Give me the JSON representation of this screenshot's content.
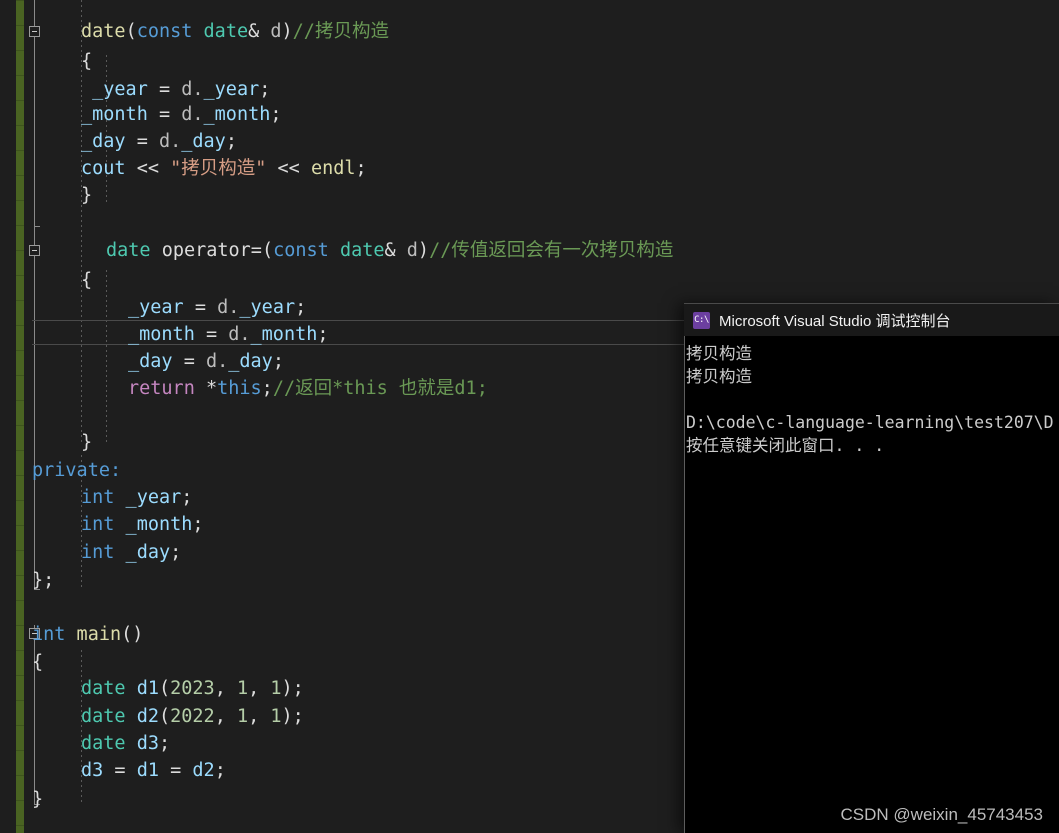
{
  "editor": {
    "theme_background": "#1e1e1e",
    "change_bar_color": "#4a6322",
    "current_line_index": 11,
    "lines": [
      {
        "indent": 0,
        "text": ""
      },
      {
        "indent": 0,
        "text": "    date(const date& d)//拷贝构造"
      },
      {
        "indent": 0,
        "text": "    {"
      },
      {
        "indent": 0,
        "text": "         _year = d._year;"
      },
      {
        "indent": 0,
        "text": "        _month = d._month;"
      },
      {
        "indent": 0,
        "text": "        _day = d._day;"
      },
      {
        "indent": 0,
        "text": "        cout << \"拷贝构造\" << endl;"
      },
      {
        "indent": 0,
        "text": "    }"
      },
      {
        "indent": 0,
        "text": ""
      },
      {
        "indent": 0,
        "text": "     date operator=(const date& d)//传值返回会有一次拷贝构造"
      },
      {
        "indent": 0,
        "text": "    {"
      },
      {
        "indent": 0,
        "text": ""
      },
      {
        "indent": 0,
        "text": "        _year = d._year;"
      },
      {
        "indent": 0,
        "text": "        _month = d._month;"
      },
      {
        "indent": 0,
        "text": "        _day = d._day;"
      },
      {
        "indent": 0,
        "text": "        return *this;//返回*this 也就是d1;"
      },
      {
        "indent": 0,
        "text": ""
      },
      {
        "indent": 0,
        "text": "    }"
      },
      {
        "indent": 0,
        "text": "private:"
      },
      {
        "indent": 0,
        "text": "    int _year;"
      },
      {
        "indent": 0,
        "text": "    int _month;"
      },
      {
        "indent": 0,
        "text": "    int _day;"
      },
      {
        "indent": 0,
        "text": "};"
      },
      {
        "indent": 0,
        "text": ""
      },
      {
        "indent": 0,
        "text": ""
      },
      {
        "indent": 0,
        "text": "int main()"
      },
      {
        "indent": 0,
        "text": "{"
      },
      {
        "indent": 0,
        "text": "    date d1(2023, 1, 1);"
      },
      {
        "indent": 0,
        "text": "    date d2(2022, 1, 1);"
      },
      {
        "indent": 0,
        "text": "    date d3;"
      },
      {
        "indent": 0,
        "text": "    d3 = d1 = d2;"
      },
      {
        "indent": 0,
        "text": "}"
      }
    ]
  },
  "console": {
    "icon": "console-window-icon",
    "icon_glyph": "C:\\",
    "title": "Microsoft Visual Studio 调试控制台",
    "output": [
      "拷贝构造",
      "拷贝构造",
      "",
      "D:\\code\\c-language-learning\\test207\\D",
      "按任意键关闭此窗口. . ."
    ]
  },
  "watermark": {
    "text": "CSDN @weixin_45743453"
  }
}
